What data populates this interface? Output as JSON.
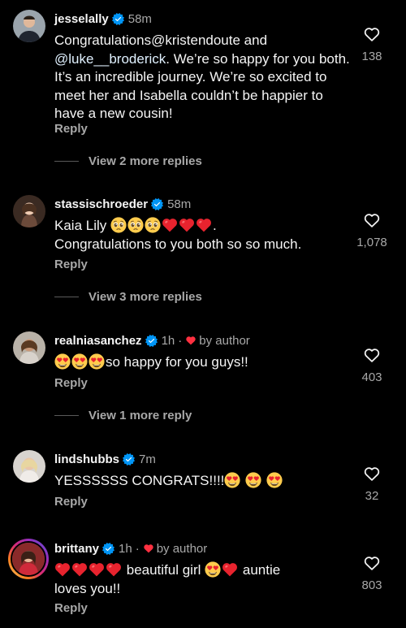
{
  "comments": [
    {
      "username": "jesselally",
      "time": "58m",
      "text_parts": [
        "Congratulations@kristendoute and ",
        "@luke__broderick",
        ". We’re so happy for you both. It’s an incredible journey. We’re so excited to meet her and Isabella couldn’t be happier to have a new cousin!"
      ],
      "reply_label": "Reply",
      "likes": "138",
      "view_more": "View 2 more replies"
    },
    {
      "username": "stassischroeder",
      "time": "58m",
      "text_a": "Kaia Lily",
      "text_b": ".",
      "text_c": "Congratulations to you both so so much.",
      "reply_label": "Reply",
      "likes": "1,078",
      "view_more": "View 3 more replies"
    },
    {
      "username": "realniasanchez",
      "time": "1h",
      "by_author": "by author",
      "text": "so happy for you guys!!",
      "reply_label": "Reply",
      "likes": "403",
      "view_more": "View 1 more reply"
    },
    {
      "username": "lindshubbs",
      "time": "7m",
      "text": "YESSSSSS CONGRATS!!!!",
      "reply_label": "Reply",
      "likes": "32"
    },
    {
      "username": "brittany",
      "time": "1h",
      "by_author": "by author",
      "text_a": "beautiful girl",
      "text_b": "auntie",
      "text_c": "loves you!!",
      "reply_label": "Reply",
      "likes": "803"
    }
  ],
  "colors": {
    "background": "#000000",
    "primary_text": "#f5f5f5",
    "secondary_text": "#a8a8a8",
    "verified_blue": "#0095f6",
    "heart_red": "#ff3040"
  },
  "icons": [
    "verified-badge-icon",
    "heart-outline-icon",
    "heart-filled-icon",
    "pleading-face-emoji",
    "red-heart-emoji",
    "heart-eyes-emoji"
  ]
}
